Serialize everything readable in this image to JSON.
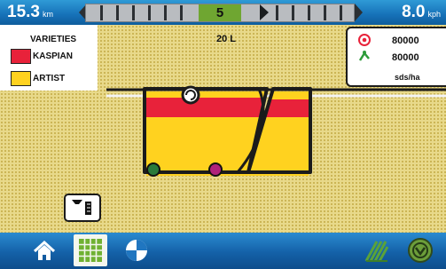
{
  "top_bar": {
    "speed_value": "15.3",
    "speed_unit": "km",
    "lightbar_number": "5",
    "right_value": "8.0",
    "right_unit": "kph"
  },
  "legend": {
    "title": "VARIETIES",
    "items": [
      {
        "label": "KASPIAN",
        "color": "#e8223a"
      },
      {
        "label": "ARTIST",
        "color": "#ffd21f"
      }
    ]
  },
  "map": {
    "width_label": "20 L",
    "colors": {
      "background": "#e8d98a",
      "planted": "#ffd21f",
      "varietyA": "#e8223a"
    }
  },
  "rates": {
    "target_value": "80000",
    "applied_value": "80000",
    "unit": "sds/ha"
  },
  "bottom_bar": {
    "buttons": [
      "home-icon",
      "map-grid-icon",
      "run-page-icon",
      "cornfield-icon",
      "menu-icon"
    ]
  }
}
